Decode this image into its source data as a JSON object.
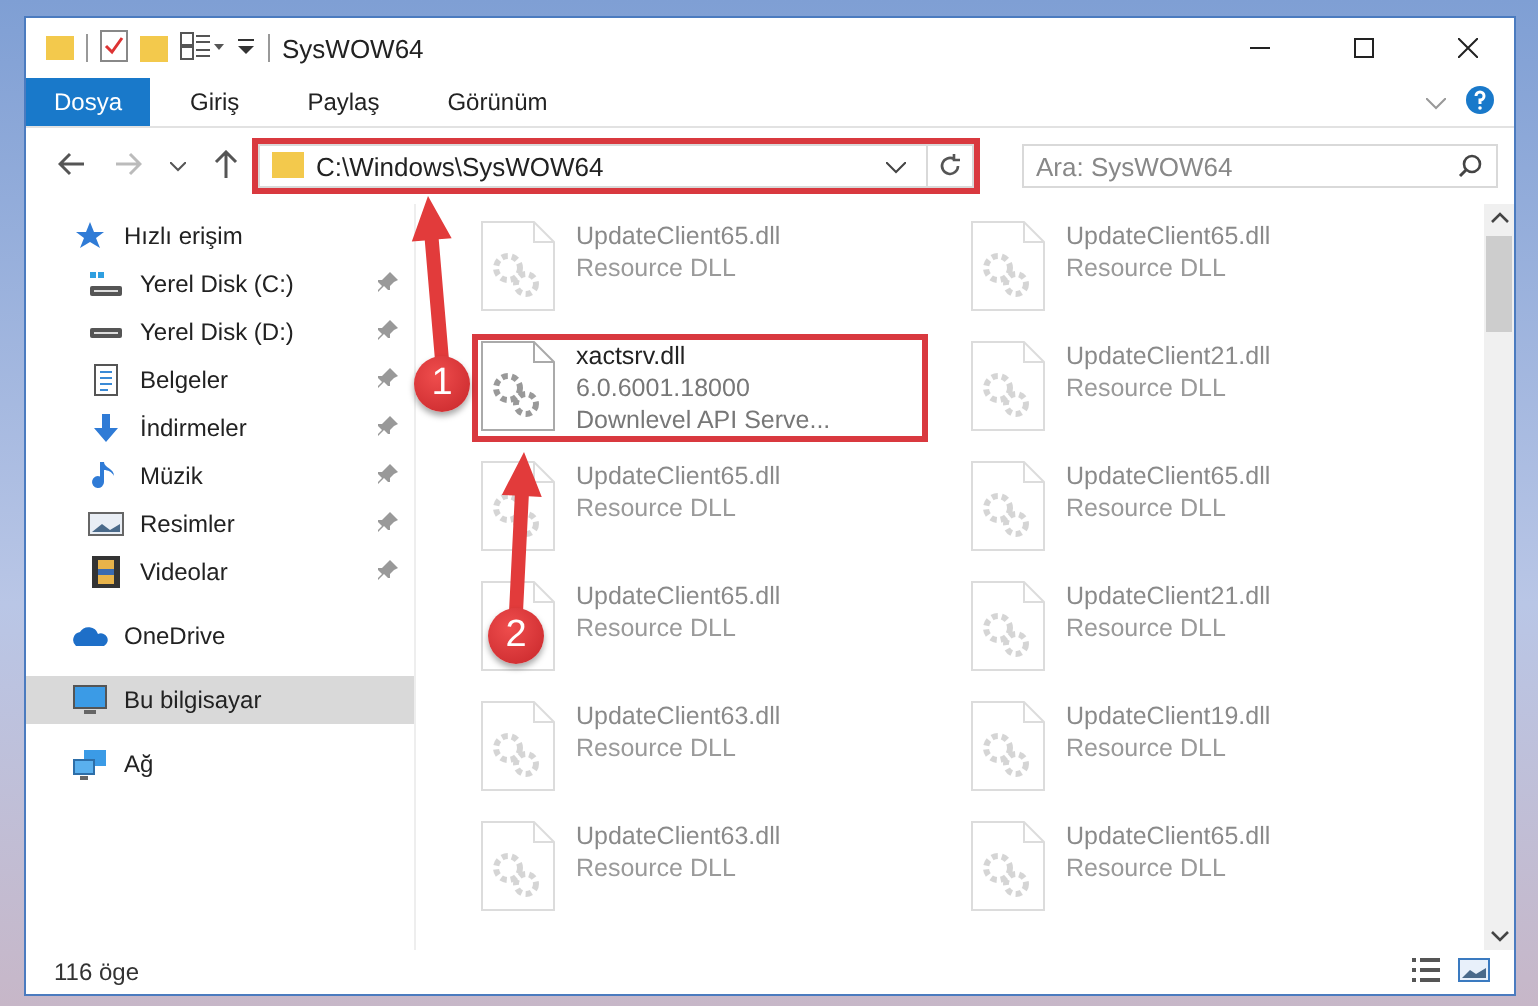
{
  "window": {
    "title": "SysWOW64"
  },
  "ribbon": {
    "tabs": [
      {
        "label": "Dosya",
        "selected": true
      },
      {
        "label": "Giriş",
        "selected": false
      },
      {
        "label": "Paylaş",
        "selected": false
      },
      {
        "label": "Görünüm",
        "selected": false
      }
    ]
  },
  "address": {
    "path": "C:\\Windows\\SysWOW64",
    "highlighted": true
  },
  "search": {
    "placeholder": "Ara: SysWOW64"
  },
  "sidebar": {
    "items": [
      {
        "label": "Hızlı erişim",
        "kind": "star",
        "pinned": false,
        "selected": false,
        "indent": false
      },
      {
        "label": "Yerel Disk (C:)",
        "kind": "drive-c",
        "pinned": true,
        "selected": false,
        "indent": true
      },
      {
        "label": "Yerel Disk (D:)",
        "kind": "drive",
        "pinned": true,
        "selected": false,
        "indent": true
      },
      {
        "label": "Belgeler",
        "kind": "doc",
        "pinned": true,
        "selected": false,
        "indent": true
      },
      {
        "label": "İndirmeler",
        "kind": "download",
        "pinned": true,
        "selected": false,
        "indent": true
      },
      {
        "label": "Müzik",
        "kind": "music",
        "pinned": true,
        "selected": false,
        "indent": true
      },
      {
        "label": "Resimler",
        "kind": "picture",
        "pinned": true,
        "selected": false,
        "indent": true
      },
      {
        "label": "Videolar",
        "kind": "video",
        "pinned": true,
        "selected": false,
        "indent": true
      },
      {
        "label": "OneDrive",
        "kind": "cloud",
        "pinned": false,
        "selected": false,
        "indent": false
      },
      {
        "label": "Bu bilgisayar",
        "kind": "pc",
        "pinned": false,
        "selected": true,
        "indent": false
      },
      {
        "label": "Ağ",
        "kind": "network",
        "pinned": false,
        "selected": false,
        "indent": false
      }
    ]
  },
  "files": [
    {
      "name": "UpdateClient65.dll",
      "details": [
        "Resource DLL"
      ],
      "highlighted": false
    },
    {
      "name": "UpdateClient65.dll",
      "details": [
        "Resource DLL"
      ],
      "highlighted": false
    },
    {
      "name": "xactsrv.dll",
      "details": [
        "6.0.6001.18000",
        "Downlevel API Serve..."
      ],
      "highlighted": true
    },
    {
      "name": "UpdateClient21.dll",
      "details": [
        "Resource DLL"
      ],
      "highlighted": false
    },
    {
      "name": "UpdateClient65.dll",
      "details": [
        "Resource DLL"
      ],
      "highlighted": false
    },
    {
      "name": "UpdateClient65.dll",
      "details": [
        "Resource DLL"
      ],
      "highlighted": false
    },
    {
      "name": "UpdateClient65.dll",
      "details": [
        "Resource DLL"
      ],
      "highlighted": false
    },
    {
      "name": "UpdateClient21.dll",
      "details": [
        "Resource DLL"
      ],
      "highlighted": false
    },
    {
      "name": "UpdateClient63.dll",
      "details": [
        "Resource DLL"
      ],
      "highlighted": false
    },
    {
      "name": "UpdateClient19.dll",
      "details": [
        "Resource DLL"
      ],
      "highlighted": false
    },
    {
      "name": "UpdateClient63.dll",
      "details": [
        "Resource DLL"
      ],
      "highlighted": false
    },
    {
      "name": "UpdateClient65.dll",
      "details": [
        "Resource DLL"
      ],
      "highlighted": false
    }
  ],
  "status_bar": {
    "count": "116 öge"
  },
  "annotations": [
    {
      "number": "1"
    },
    {
      "number": "2"
    }
  ]
}
